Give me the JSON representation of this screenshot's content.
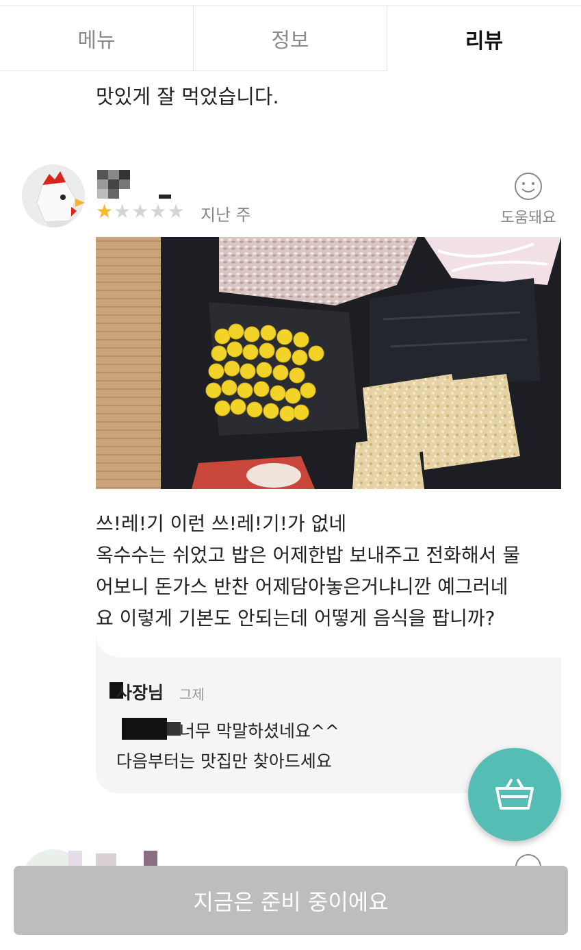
{
  "tabs": [
    {
      "label": "메뉴",
      "active": false
    },
    {
      "label": "정보",
      "active": false
    },
    {
      "label": "리뷰",
      "active": true
    }
  ],
  "previous_review": {
    "text": "맛있게 잘 먹었습니다."
  },
  "review": {
    "rating": 1,
    "max_rating": 5,
    "date": "지난 주",
    "helpful_label": "도움돼요",
    "text_lines": [
      "쓰!레!기 이런 쓰!레!기!가 없네",
      "옥수수는 쉬었고 밥은 어제한밥 보내주고 전화해서 물",
      "어보니 돈가스 반찬 어제담아놓은거냐니깐 예그러네",
      "요 이렇게 기본도 안되는데 어떻게 음식을 팝니까?"
    ],
    "reply": {
      "owner": "사장님",
      "time": "그제",
      "lines": [
        "너무 막말하셨네요^^",
        "다음부터는 맛집만 찾아드세요"
      ]
    }
  },
  "bottom_button": {
    "label": "지금은 준비 중이에요"
  },
  "colors": {
    "accent": "#55bdb3",
    "star": "#f5b82e",
    "disabled": "#bdbdbd"
  },
  "icons": [
    "smile-icon",
    "basket-icon",
    "star-icon"
  ]
}
